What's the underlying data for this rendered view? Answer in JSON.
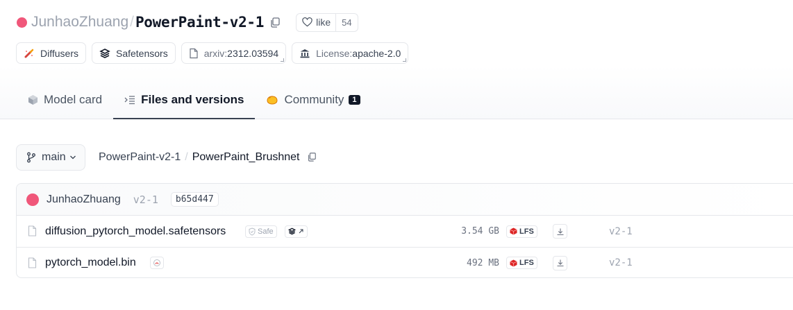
{
  "repo": {
    "owner": "JunhaoZhuang",
    "separator": "/",
    "name": "PowerPaint-v2-1",
    "like_label": "like",
    "like_count": "54",
    "owner_color": "#f0577a"
  },
  "tags": [
    {
      "icon": "diffusers-icon",
      "label": "Diffusers"
    },
    {
      "icon": "safetensors-icon",
      "label": "Safetensors"
    },
    {
      "icon": "paper-icon",
      "prefix": "arxiv:",
      "value": "2312.03594"
    },
    {
      "icon": "bank-icon",
      "prefix": "License: ",
      "value": "apache-2.0"
    }
  ],
  "tabs": [
    {
      "icon": "cube-icon",
      "label": "Model card",
      "active": false
    },
    {
      "icon": "files-icon",
      "label": "Files and versions",
      "active": true
    },
    {
      "icon": "community-icon",
      "label": "Community",
      "badge": "1",
      "active": false
    }
  ],
  "branch": {
    "name": "main"
  },
  "breadcrumb": {
    "root": "PowerPaint-v2-1",
    "sep": "/",
    "current": "PowerPaint_Brushnet"
  },
  "commit": {
    "author": "JunhaoZhuang",
    "branch": "v2-1",
    "hash": "b65d447"
  },
  "files": [
    {
      "name": "diffusion_pytorch_model.safetensors",
      "safe_label": "Safe",
      "size": "3.54 GB",
      "lfs": "LFS",
      "branch": "v2-1"
    },
    {
      "name": "pytorch_model.bin",
      "size": "492 MB",
      "lfs": "LFS",
      "branch": "v2-1"
    }
  ]
}
